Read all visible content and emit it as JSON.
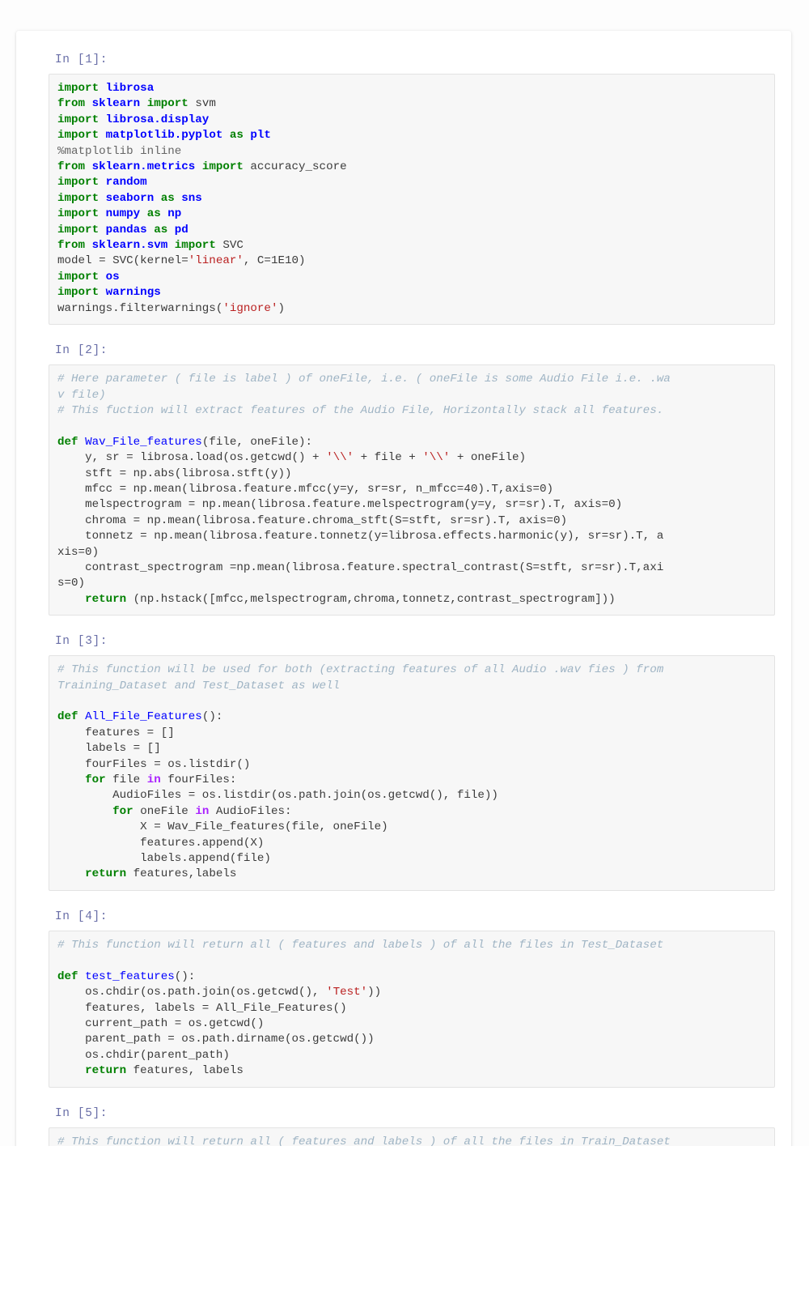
{
  "app": {
    "type": "jupyter-notebook",
    "background_color": "#fdfdfd",
    "sheet_color": "#ffffff",
    "cell_background_color": "#f7f7f7",
    "cell_border_color": "#e3e3e3",
    "prompt_color": "#6a6fa8",
    "syntax_colors": {
      "keyword": "#008000",
      "operator_keyword": "#aa22ff",
      "module": "#0000ff",
      "function": "#0000ff",
      "string": "#ba2121",
      "comment": "#9fb4c4",
      "text": "#3b3b3b"
    }
  },
  "cells": [
    {
      "prompt": "In [1]:",
      "lines": [
        [
          {
            "t": "import ",
            "c": "k"
          },
          {
            "t": "librosa",
            "c": "nn"
          }
        ],
        [
          {
            "t": "from ",
            "c": "k"
          },
          {
            "t": "sklearn ",
            "c": "nn"
          },
          {
            "t": "import ",
            "c": "k"
          },
          {
            "t": "svm",
            "c": "n"
          }
        ],
        [
          {
            "t": "import ",
            "c": "k"
          },
          {
            "t": "librosa.display",
            "c": "nn"
          }
        ],
        [
          {
            "t": "import ",
            "c": "k"
          },
          {
            "t": "matplotlib.pyplot ",
            "c": "nn"
          },
          {
            "t": "as ",
            "c": "k"
          },
          {
            "t": "plt",
            "c": "nn"
          }
        ],
        [
          {
            "t": "%matplotlib inline",
            "c": "o"
          }
        ],
        [
          {
            "t": "from ",
            "c": "k"
          },
          {
            "t": "sklearn.metrics ",
            "c": "nn"
          },
          {
            "t": "import ",
            "c": "k"
          },
          {
            "t": "accuracy_score",
            "c": "n"
          }
        ],
        [
          {
            "t": "import ",
            "c": "k"
          },
          {
            "t": "random",
            "c": "nn"
          }
        ],
        [
          {
            "t": "import ",
            "c": "k"
          },
          {
            "t": "seaborn ",
            "c": "nn"
          },
          {
            "t": "as ",
            "c": "k"
          },
          {
            "t": "sns",
            "c": "nn"
          }
        ],
        [
          {
            "t": "import ",
            "c": "k"
          },
          {
            "t": "numpy ",
            "c": "nn"
          },
          {
            "t": "as ",
            "c": "k"
          },
          {
            "t": "np",
            "c": "nn"
          }
        ],
        [
          {
            "t": "import ",
            "c": "k"
          },
          {
            "t": "pandas ",
            "c": "nn"
          },
          {
            "t": "as ",
            "c": "k"
          },
          {
            "t": "pd",
            "c": "nn"
          }
        ],
        [
          {
            "t": "from ",
            "c": "k"
          },
          {
            "t": "sklearn.svm ",
            "c": "nn"
          },
          {
            "t": "import ",
            "c": "k"
          },
          {
            "t": "SVC",
            "c": "n"
          }
        ],
        [
          {
            "t": "model = SVC(kernel=",
            "c": "n"
          },
          {
            "t": "'linear'",
            "c": "s"
          },
          {
            "t": ", C=1E10)",
            "c": "n"
          }
        ],
        [
          {
            "t": "import ",
            "c": "k"
          },
          {
            "t": "os",
            "c": "nn"
          }
        ],
        [
          {
            "t": "import ",
            "c": "k"
          },
          {
            "t": "warnings",
            "c": "nn"
          }
        ],
        [
          {
            "t": "warnings.filterwarnings(",
            "c": "n"
          },
          {
            "t": "'ignore'",
            "c": "s"
          },
          {
            "t": ")",
            "c": "n"
          }
        ]
      ]
    },
    {
      "prompt": "In [2]:",
      "lines": [
        [
          {
            "t": "# Here parameter ( file is label ) of oneFile, i.e. ( oneFile is some Audio File i.e. .wa",
            "c": "c"
          }
        ],
        [
          {
            "t": "v file)",
            "c": "c"
          }
        ],
        [
          {
            "t": "# This fuction will extract features of the Audio File, Horizontally stack all features.",
            "c": "c"
          }
        ],
        [
          {
            "t": "",
            "c": "n"
          }
        ],
        [
          {
            "t": "def ",
            "c": "k"
          },
          {
            "t": "Wav_File_features",
            "c": "nf"
          },
          {
            "t": "(file, oneFile):",
            "c": "n"
          }
        ],
        [
          {
            "t": "    y, sr = librosa.load(os.getcwd() + ",
            "c": "n"
          },
          {
            "t": "'\\\\'",
            "c": "s"
          },
          {
            "t": " + file + ",
            "c": "n"
          },
          {
            "t": "'\\\\'",
            "c": "s"
          },
          {
            "t": " + oneFile)",
            "c": "n"
          }
        ],
        [
          {
            "t": "    stft = np.abs(librosa.stft(y))",
            "c": "n"
          }
        ],
        [
          {
            "t": "    mfcc = np.mean(librosa.feature.mfcc(y=y, sr=sr, n_mfcc=40).T,axis=0)",
            "c": "n"
          }
        ],
        [
          {
            "t": "    melspectrogram = np.mean(librosa.feature.melspectrogram(y=y, sr=sr).T, axis=0)",
            "c": "n"
          }
        ],
        [
          {
            "t": "    chroma = np.mean(librosa.feature.chroma_stft(S=stft, sr=sr).T, axis=0)",
            "c": "n"
          }
        ],
        [
          {
            "t": "    tonnetz = np.mean(librosa.feature.tonnetz(y=librosa.effects.harmonic(y), sr=sr).T, a",
            "c": "n"
          }
        ],
        [
          {
            "t": "xis=0)",
            "c": "n"
          }
        ],
        [
          {
            "t": "    contrast_spectrogram =np.mean(librosa.feature.spectral_contrast(S=stft, sr=sr).T,axi",
            "c": "n"
          }
        ],
        [
          {
            "t": "s=0)",
            "c": "n"
          }
        ],
        [
          {
            "t": "    ",
            "c": "n"
          },
          {
            "t": "return ",
            "c": "k"
          },
          {
            "t": "(np.hstack([mfcc,melspectrogram,chroma,tonnetz,contrast_spectrogram]))",
            "c": "n"
          }
        ]
      ]
    },
    {
      "prompt": "In [3]:",
      "lines": [
        [
          {
            "t": "# This function will be used for both (extracting features of all Audio .wav fies ) from",
            "c": "c"
          }
        ],
        [
          {
            "t": "Training_Dataset and Test_Dataset as well",
            "c": "c"
          }
        ],
        [
          {
            "t": "",
            "c": "n"
          }
        ],
        [
          {
            "t": "def ",
            "c": "k"
          },
          {
            "t": "All_File_Features",
            "c": "nf"
          },
          {
            "t": "():",
            "c": "n"
          }
        ],
        [
          {
            "t": "    features = []",
            "c": "n"
          }
        ],
        [
          {
            "t": "    labels = []",
            "c": "n"
          }
        ],
        [
          {
            "t": "    fourFiles = os.listdir()",
            "c": "n"
          }
        ],
        [
          {
            "t": "    ",
            "c": "n"
          },
          {
            "t": "for ",
            "c": "k"
          },
          {
            "t": "file ",
            "c": "n"
          },
          {
            "t": "in ",
            "c": "kw"
          },
          {
            "t": "fourFiles:",
            "c": "n"
          }
        ],
        [
          {
            "t": "        AudioFiles = os.listdir(os.path.join(os.getcwd(), file))",
            "c": "n"
          }
        ],
        [
          {
            "t": "        ",
            "c": "n"
          },
          {
            "t": "for ",
            "c": "k"
          },
          {
            "t": "oneFile ",
            "c": "n"
          },
          {
            "t": "in ",
            "c": "kw"
          },
          {
            "t": "AudioFiles:",
            "c": "n"
          }
        ],
        [
          {
            "t": "            X = Wav_File_features(file, oneFile)",
            "c": "n"
          }
        ],
        [
          {
            "t": "            features.append(X)",
            "c": "n"
          }
        ],
        [
          {
            "t": "            labels.append(file)",
            "c": "n"
          }
        ],
        [
          {
            "t": "    ",
            "c": "n"
          },
          {
            "t": "return ",
            "c": "k"
          },
          {
            "t": "features,labels",
            "c": "n"
          }
        ]
      ]
    },
    {
      "prompt": "In [4]:",
      "lines": [
        [
          {
            "t": "# This function will return all ( features and labels ) of all the files in Test_Dataset",
            "c": "c"
          }
        ],
        [
          {
            "t": "",
            "c": "n"
          }
        ],
        [
          {
            "t": "def ",
            "c": "k"
          },
          {
            "t": "test_features",
            "c": "nf"
          },
          {
            "t": "():",
            "c": "n"
          }
        ],
        [
          {
            "t": "    os.chdir(os.path.join(os.getcwd(), ",
            "c": "n"
          },
          {
            "t": "'Test'",
            "c": "s"
          },
          {
            "t": "))",
            "c": "n"
          }
        ],
        [
          {
            "t": "    features, labels = All_File_Features()",
            "c": "n"
          }
        ],
        [
          {
            "t": "    current_path = os.getcwd()",
            "c": "n"
          }
        ],
        [
          {
            "t": "    parent_path = os.path.dirname(os.getcwd())",
            "c": "n"
          }
        ],
        [
          {
            "t": "    os.chdir(parent_path)",
            "c": "n"
          }
        ],
        [
          {
            "t": "    ",
            "c": "n"
          },
          {
            "t": "return ",
            "c": "k"
          },
          {
            "t": "features, labels",
            "c": "n"
          }
        ]
      ]
    },
    {
      "prompt": "In [5]:",
      "lines": [
        [
          {
            "t": "# This function will return all ( features and labels ) of all the files in Train_Dataset",
            "c": "c"
          }
        ]
      ]
    }
  ]
}
